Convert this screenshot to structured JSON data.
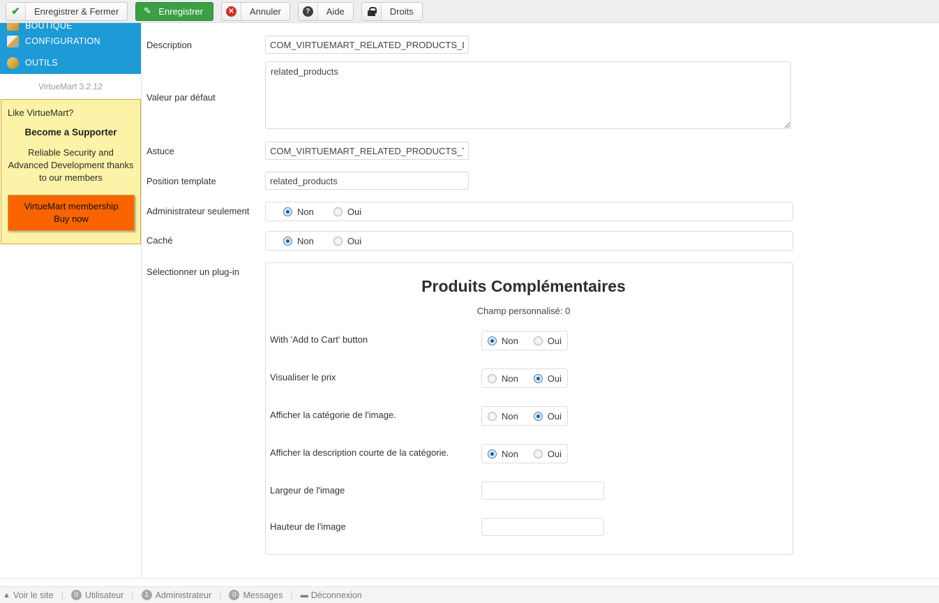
{
  "toolbar": {
    "buttons": [
      {
        "label": "Enregistrer & Fermer",
        "icon": "check-icon",
        "primary": false
      },
      {
        "label": "Enregistrer",
        "icon": "pencil-icon",
        "primary": true
      },
      {
        "label": "Annuler",
        "icon": "cancel-icon",
        "primary": false
      },
      {
        "label": "Aide",
        "icon": "help-icon",
        "primary": false
      },
      {
        "label": "Droits",
        "icon": "lock-icon",
        "primary": false
      }
    ]
  },
  "sidebar": {
    "nav": [
      {
        "label": "BOUTIQUE",
        "icon": "shop-icon"
      },
      {
        "label": "CONFIGURATION",
        "icon": "config-icon"
      },
      {
        "label": "OUTILS",
        "icon": "tools-icon"
      }
    ],
    "version": "VirtueMart 3.2.12",
    "supporter": {
      "question": "Like VirtueMart?",
      "headline": "Become a Supporter",
      "tagline": "Reliable Security and Advanced Development thanks to our members",
      "button_line1": "VirtueMart membership",
      "button_line2": "Buy now"
    },
    "colors": {
      "nav_bg": "#1e9ad6",
      "box_bg": "#fdf3a8",
      "buy_bg": "#fa6400"
    }
  },
  "form": {
    "description": {
      "label": "Description",
      "value": "COM_VIRTUEMART_RELATED_PRODUCTS_DE",
      "placeholder": ""
    },
    "default_value": {
      "label": "Valeur par défaut",
      "value": "related_products",
      "placeholder": ""
    },
    "tip": {
      "label": "Astuce",
      "value": "COM_VIRTUEMART_RELATED_PRODUCTS_TII",
      "placeholder": ""
    },
    "template_position": {
      "label": "Position template",
      "value": "related_products",
      "placeholder": ""
    },
    "admin_only": {
      "label": "Administrateur seulement",
      "options": [
        "Non",
        "Oui"
      ],
      "selected": "Non"
    },
    "hidden": {
      "label": "Caché",
      "options": [
        "Non",
        "Oui"
      ],
      "selected": "Non"
    },
    "select_plugin": {
      "label": "Sélectionner un plug-in"
    }
  },
  "plugin": {
    "title": "Produits Complémentaires",
    "subtitle": "Champ personnalisé: 0",
    "rows": [
      {
        "label": "With 'Add to Cart' button",
        "type": "radio",
        "options": [
          "Non",
          "Oui"
        ],
        "selected": "Non"
      },
      {
        "label": "Visualiser le prix",
        "type": "radio",
        "options": [
          "Non",
          "Oui"
        ],
        "selected": "Oui"
      },
      {
        "label": "Afficher la catégorie de l'image.",
        "type": "radio",
        "options": [
          "Non",
          "Oui"
        ],
        "selected": "Oui"
      },
      {
        "label": "Afficher la description courte de la catégorie.",
        "type": "radio",
        "options": [
          "Non",
          "Oui"
        ],
        "selected": "Non"
      },
      {
        "label": "Largeur de l'image",
        "type": "text",
        "value": "",
        "placeholder": ""
      },
      {
        "label": "Hauteur de l'image",
        "type": "text",
        "value": "",
        "placeholder": ""
      }
    ]
  },
  "footer": {
    "view_site": "Voir le site",
    "users": {
      "count": "0",
      "label": "Utilisateur"
    },
    "admins": {
      "count": "1",
      "label": "Administrateur"
    },
    "messages": {
      "count": "0",
      "label": "Messages"
    },
    "logout": "Déconnexion"
  }
}
